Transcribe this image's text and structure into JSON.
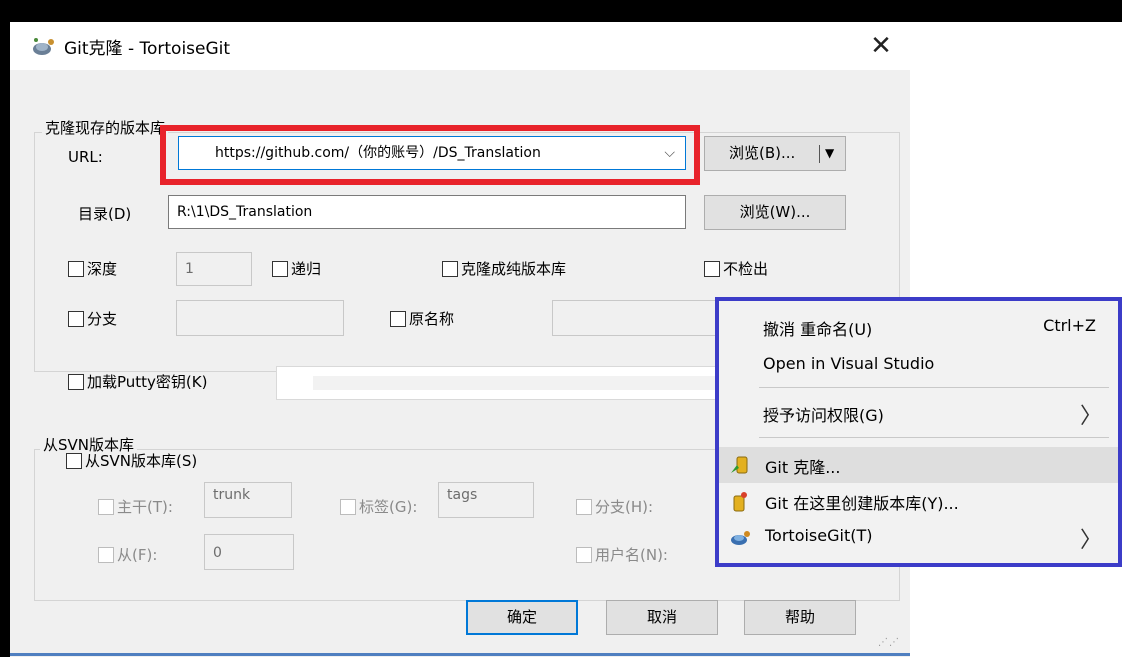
{
  "window": {
    "title": "Git克隆 - TortoiseGit",
    "close_symbol": "✕"
  },
  "clone_group": {
    "title": "克隆现存的版本库",
    "url_label": "URL:",
    "url_value": "https://github.com/（你的账号）/DS_Translation",
    "url_dropdown_symbol": "⌵",
    "browse_b": "浏览(B)...",
    "browse_b_arrow": "▼",
    "dir_label": "目录(D)",
    "dir_value": "R:\\1\\DS_Translation",
    "browse_w": "浏览(W)...",
    "depth_label": "深度",
    "depth_value": "1",
    "recursive_label": "递归",
    "bare_label": "克隆成纯版本库",
    "no_checkout_label": "不检出",
    "branch_label": "分支",
    "origin_label": "原名称"
  },
  "putty": {
    "label": "加载Putty密钥(K)"
  },
  "svn_group": {
    "title": "从SVN版本库",
    "from_svn_label": "从SVN版本库(S)",
    "trunk_label": "主干(T):",
    "trunk_value": "trunk",
    "tags_label": "标签(G):",
    "tags_value": "tags",
    "branch_label": "分支(H):",
    "from_label": "从(F):",
    "from_value": "0",
    "username_label": "用户名(N):"
  },
  "buttons": {
    "ok": "确定",
    "cancel": "取消",
    "help": "帮助"
  },
  "context_menu": {
    "undo_rename": "撤消 重命名(U)",
    "undo_shortcut": "Ctrl+Z",
    "open_vs": "Open in Visual Studio",
    "grant_access": "授予访问权限(G)",
    "git_clone": "Git 克隆...",
    "git_create_repo": "Git 在这里创建版本库(Y)...",
    "tortoisegit": "TortoiseGit(T)",
    "submenu_arrow": "〉"
  },
  "colors": {
    "highlight_red": "#e8232b",
    "menu_border_blue": "#3c3cc8",
    "accent_blue": "#0078d7"
  }
}
